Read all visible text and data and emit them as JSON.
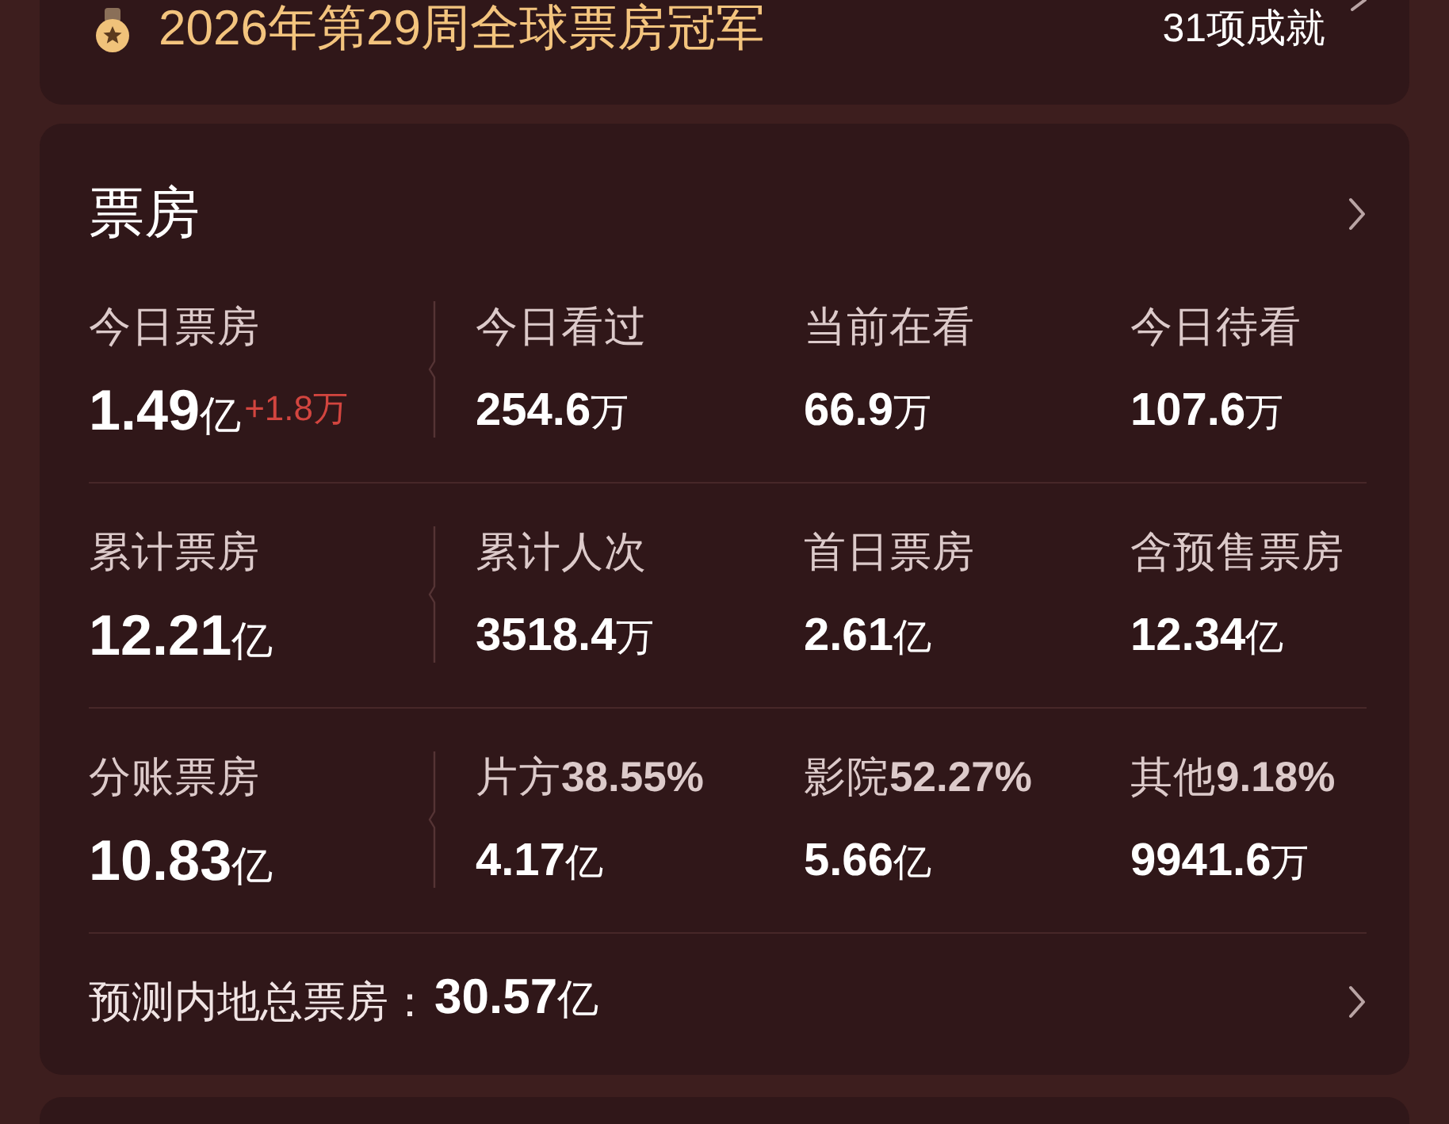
{
  "banner": {
    "title": "2026年第29周全球票房冠军",
    "achievements": "31项成就"
  },
  "box_office": {
    "title": "票房",
    "rows": [
      {
        "main": {
          "label": "今日票房",
          "value": "1.49",
          "unit": "亿",
          "change": "+1.8万"
        },
        "items": [
          {
            "label": "今日看过",
            "value": "254.6",
            "unit": "万"
          },
          {
            "label": "当前在看",
            "value": "66.9",
            "unit": "万"
          },
          {
            "label": "今日待看",
            "value": "107.6",
            "unit": "万"
          }
        ]
      },
      {
        "main": {
          "label": "累计票房",
          "value": "12.21",
          "unit": "亿"
        },
        "items": [
          {
            "label": "累计人次",
            "value": "3518.4",
            "unit": "万"
          },
          {
            "label": "首日票房",
            "value": "2.61",
            "unit": "亿"
          },
          {
            "label": "含预售票房",
            "value": "12.34",
            "unit": "亿"
          }
        ]
      },
      {
        "main": {
          "label": "分账票房",
          "value": "10.83",
          "unit": "亿"
        },
        "items": [
          {
            "label": "片方**38.55%**",
            "value": "4.17",
            "unit": "亿"
          },
          {
            "label": "影院**52.27%**",
            "value": "5.66",
            "unit": "亿"
          },
          {
            "label": "其他**9.18%**",
            "value": "9941.6",
            "unit": "万"
          }
        ]
      }
    ],
    "forecast": {
      "label": "预测内地总票房：",
      "value": "30.57",
      "unit": "亿"
    }
  }
}
